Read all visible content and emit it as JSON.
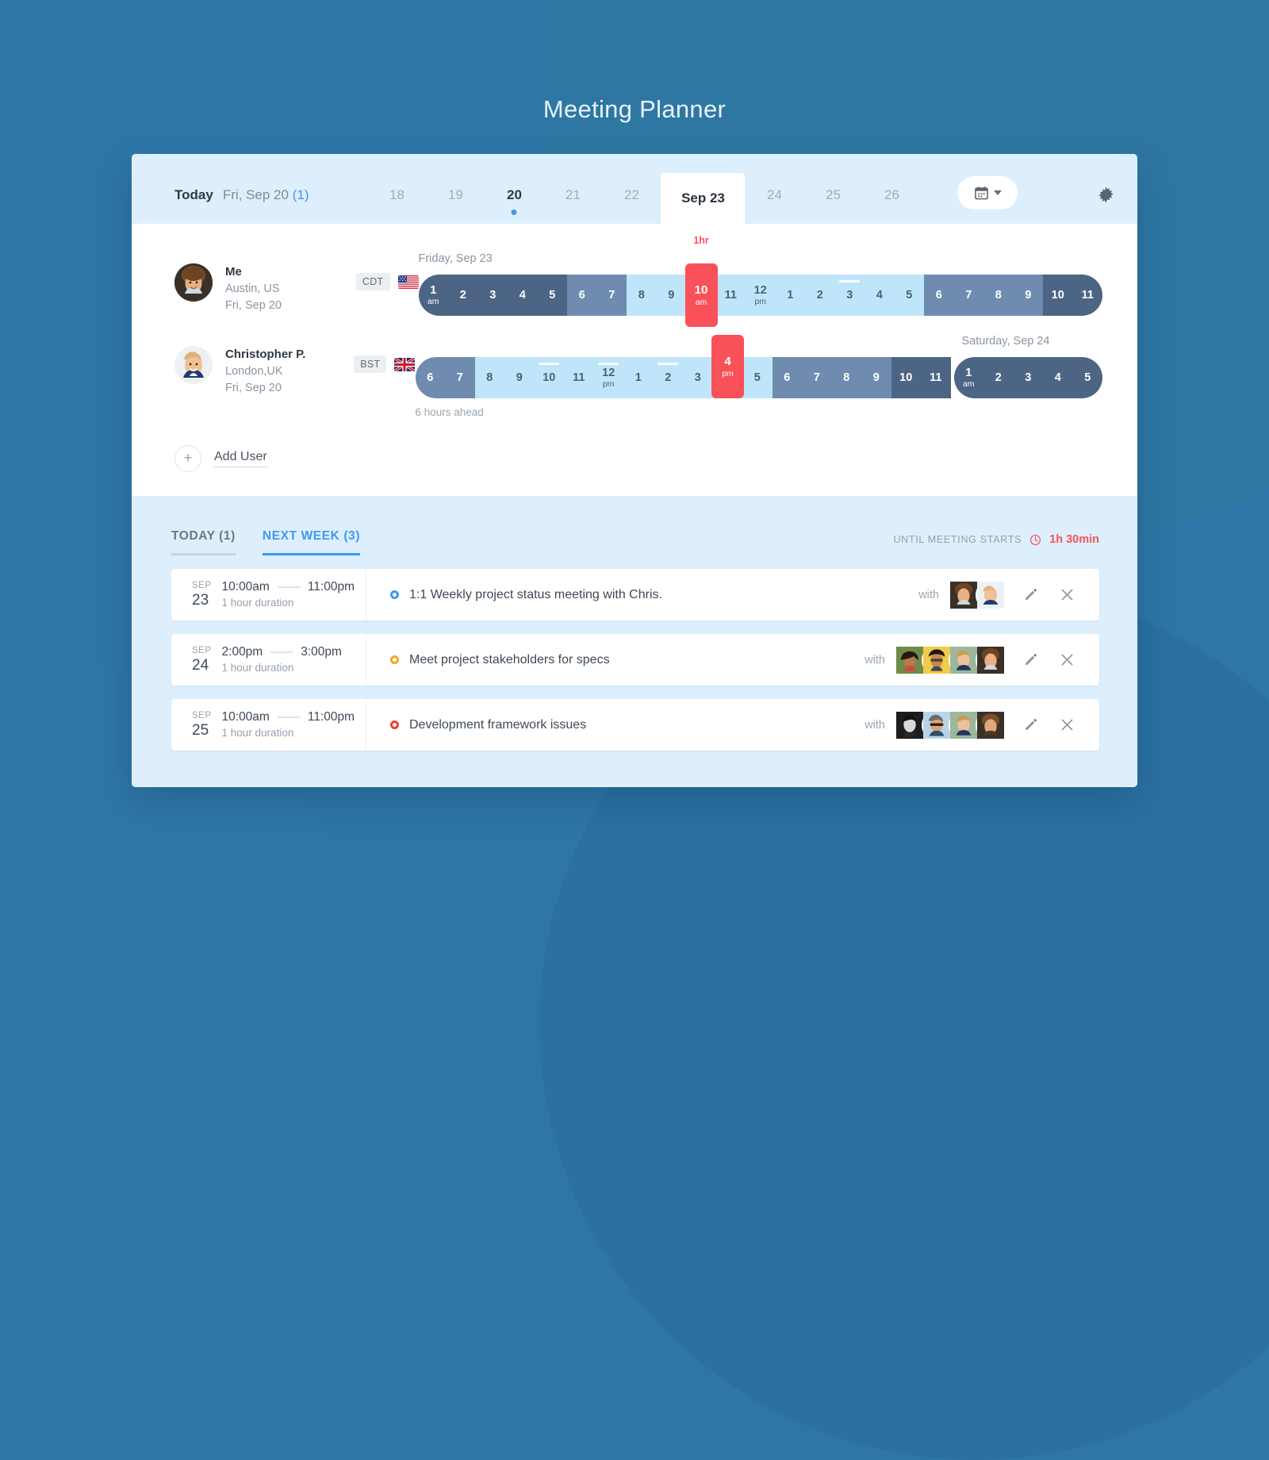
{
  "app": {
    "title": "Meeting Planner"
  },
  "theme": {
    "bg": "#2e76a8",
    "panel_light": "#ddeffc",
    "accent_blue": "#3f97f6",
    "accent_red": "#f8515a",
    "accent_orange": "#f5a623",
    "slot_dark": "#4d6585",
    "slot_mid": "#6f8cb0",
    "slot_light": "#bfe5fa"
  },
  "datebar": {
    "today_label": "Today",
    "today_date": "Fri, Sep 20",
    "today_count": "(1)",
    "days": [
      {
        "label": "18",
        "state": "normal"
      },
      {
        "label": "19",
        "state": "normal"
      },
      {
        "label": "20",
        "state": "current"
      },
      {
        "label": "21",
        "state": "normal"
      },
      {
        "label": "22",
        "state": "normal"
      },
      {
        "label": "Sep 23",
        "state": "selected"
      },
      {
        "label": "24",
        "state": "normal"
      },
      {
        "label": "25",
        "state": "normal"
      },
      {
        "label": "26",
        "state": "normal"
      }
    ],
    "calendar_icon": "calendar-icon",
    "caret_icon": "chevron-down-icon",
    "settings_icon": "gear-icon"
  },
  "planner": {
    "people": [
      {
        "name": "Me",
        "city": "Austin, US",
        "date": "Fri, Sep 20",
        "timezone": "CDT",
        "flag": "us-flag-icon",
        "day_label": "Friday, Sep 23",
        "offset_note": "",
        "now": {
          "hour": "10",
          "suffix": "am",
          "duration_label": "1hr"
        },
        "slots": [
          {
            "h": "1",
            "s": "am",
            "tone": "dark"
          },
          {
            "h": "2",
            "s": "",
            "tone": "dark"
          },
          {
            "h": "3",
            "s": "",
            "tone": "dark"
          },
          {
            "h": "4",
            "s": "",
            "tone": "dark"
          },
          {
            "h": "5",
            "s": "",
            "tone": "dark"
          },
          {
            "h": "6",
            "s": "",
            "tone": "mid"
          },
          {
            "h": "7",
            "s": "",
            "tone": "mid"
          },
          {
            "h": "8",
            "s": "",
            "tone": "light"
          },
          {
            "h": "9",
            "s": "",
            "tone": "light"
          },
          {
            "h": "10",
            "s": "am",
            "tone": "now"
          },
          {
            "h": "11",
            "s": "",
            "tone": "light"
          },
          {
            "h": "12",
            "s": "pm",
            "tone": "light"
          },
          {
            "h": "1",
            "s": "",
            "tone": "light"
          },
          {
            "h": "2",
            "s": "",
            "tone": "light"
          },
          {
            "h": "3",
            "s": "",
            "tone": "light",
            "tick": true
          },
          {
            "h": "4",
            "s": "",
            "tone": "light"
          },
          {
            "h": "5",
            "s": "",
            "tone": "light"
          },
          {
            "h": "6",
            "s": "",
            "tone": "mid"
          },
          {
            "h": "7",
            "s": "",
            "tone": "mid"
          },
          {
            "h": "8",
            "s": "",
            "tone": "mid"
          },
          {
            "h": "9",
            "s": "",
            "tone": "mid"
          },
          {
            "h": "10",
            "s": "",
            "tone": "dark"
          },
          {
            "h": "11",
            "s": "",
            "tone": "dark"
          }
        ]
      },
      {
        "name": "Christopher P.",
        "city": "London,UK",
        "date": "Fri, Sep 20",
        "timezone": "BST",
        "flag": "uk-flag-icon",
        "day_label": "",
        "next_day_label": "Saturday, Sep 24",
        "offset_note": "6 hours ahead",
        "now": {
          "hour": "4",
          "suffix": "pm",
          "duration_label": ""
        },
        "slots": [
          {
            "h": "6",
            "s": "",
            "tone": "mid"
          },
          {
            "h": "7",
            "s": "",
            "tone": "mid"
          },
          {
            "h": "8",
            "s": "",
            "tone": "light"
          },
          {
            "h": "9",
            "s": "",
            "tone": "light"
          },
          {
            "h": "10",
            "s": "",
            "tone": "light",
            "tick": true
          },
          {
            "h": "11",
            "s": "",
            "tone": "light"
          },
          {
            "h": "12",
            "s": "pm",
            "tone": "light",
            "tick": true
          },
          {
            "h": "1",
            "s": "",
            "tone": "light"
          },
          {
            "h": "2",
            "s": "",
            "tone": "light",
            "tick": true
          },
          {
            "h": "3",
            "s": "",
            "tone": "light"
          },
          {
            "h": "4",
            "s": "pm",
            "tone": "now"
          },
          {
            "h": "5",
            "s": "",
            "tone": "light"
          },
          {
            "h": "6",
            "s": "",
            "tone": "mid"
          },
          {
            "h": "7",
            "s": "",
            "tone": "mid"
          },
          {
            "h": "8",
            "s": "",
            "tone": "mid"
          },
          {
            "h": "9",
            "s": "",
            "tone": "mid"
          },
          {
            "h": "10",
            "s": "",
            "tone": "dark"
          },
          {
            "h": "11",
            "s": "",
            "tone": "dark"
          }
        ],
        "next_day_slots": [
          {
            "h": "1",
            "s": "am",
            "tone": "dark"
          },
          {
            "h": "2",
            "s": "",
            "tone": "dark"
          },
          {
            "h": "3",
            "s": "",
            "tone": "dark"
          },
          {
            "h": "4",
            "s": "",
            "tone": "dark"
          },
          {
            "h": "5",
            "s": "",
            "tone": "dark"
          }
        ]
      }
    ],
    "add_user_label": "Add User",
    "add_user_icon": "plus-icon"
  },
  "bottom": {
    "tabs": [
      {
        "label": "TODAY (1)",
        "active": false
      },
      {
        "label": "NEXT WEEK (3)",
        "active": true
      }
    ],
    "until_label": "UNTIL MEETING STARTS",
    "until_value": "1h 30min",
    "clock_icon": "clock-icon",
    "with_label": "with",
    "edit_icon": "pencil-icon",
    "delete_icon": "close-icon",
    "meetings": [
      {
        "month": "SEP",
        "day": "23",
        "start": "10:00am",
        "end": "11:00pm",
        "duration": "1 hour duration",
        "title": "1:1 Weekly project status meeting with Chris.",
        "dot_color": "#3f97f6",
        "attendees": 2
      },
      {
        "month": "SEP",
        "day": "24",
        "start": "2:00pm",
        "end": "3:00pm",
        "duration": "1 hour duration",
        "title": "Meet project stakeholders for specs",
        "dot_color": "#f5a623",
        "attendees": 4
      },
      {
        "month": "SEP",
        "day": "25",
        "start": "10:00am",
        "end": "11:00pm",
        "duration": "1 hour duration",
        "title": "Development framework issues",
        "dot_color": "#ef3e36",
        "attendees": 4
      }
    ]
  }
}
